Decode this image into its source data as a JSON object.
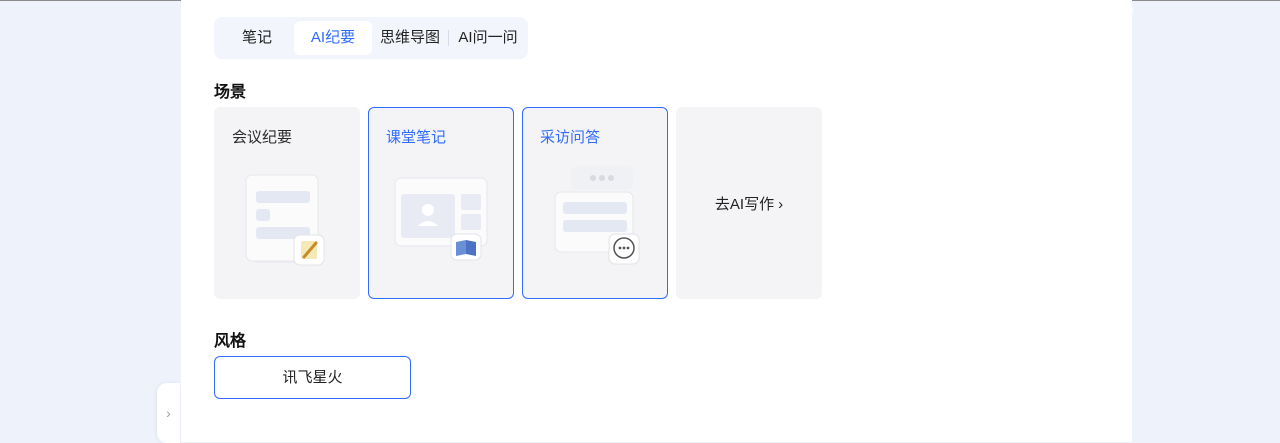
{
  "tabs": [
    {
      "label": "笔记",
      "active": false
    },
    {
      "label": "AI纪要",
      "active": true
    },
    {
      "label": "思维导图",
      "active": false
    },
    {
      "label": "AI问一问",
      "active": false
    }
  ],
  "scene": {
    "title": "场景",
    "cards": [
      {
        "label": "会议纪要",
        "selected": false,
        "icon": "memo-pencil-icon"
      },
      {
        "label": "课堂笔记",
        "selected": true,
        "icon": "open-book-icon"
      },
      {
        "label": "采访问答",
        "selected": true,
        "icon": "speech-bubble-icon"
      }
    ],
    "goto_label": "去AI写作",
    "goto_icon": "chevron-right-icon"
  },
  "style": {
    "title": "风格",
    "selected_label": "讯飞星火"
  },
  "side_toggle_icon": "chevron-right-icon",
  "colors": {
    "accent": "#2f6bff",
    "page_bg": "#eef2fb",
    "card_bg": "#f4f4f6"
  }
}
